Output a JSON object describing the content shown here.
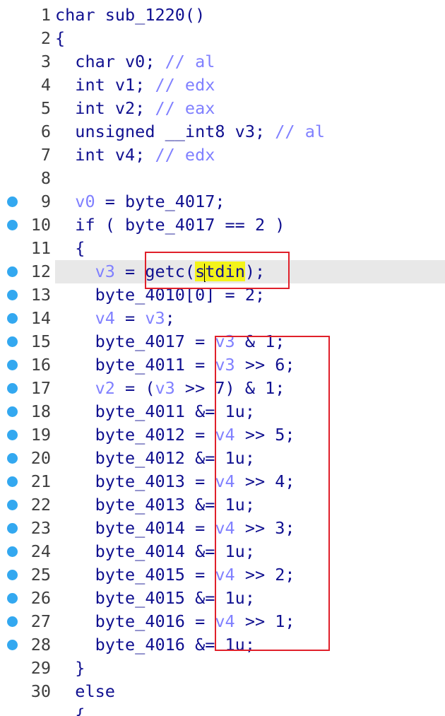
{
  "editor": {
    "lines": [
      {
        "n": "1",
        "bp": false,
        "parts": [
          [
            "plain",
            "char sub_1220()"
          ]
        ]
      },
      {
        "n": "2",
        "bp": false,
        "parts": [
          [
            "plain",
            "{"
          ]
        ]
      },
      {
        "n": "3",
        "bp": false,
        "parts": [
          [
            "plain",
            "  char v0; "
          ],
          [
            "cm",
            "// al"
          ]
        ]
      },
      {
        "n": "4",
        "bp": false,
        "parts": [
          [
            "plain",
            "  int v1; "
          ],
          [
            "cm",
            "// edx"
          ]
        ]
      },
      {
        "n": "5",
        "bp": false,
        "parts": [
          [
            "plain",
            "  int v2; "
          ],
          [
            "cm",
            "// eax"
          ]
        ]
      },
      {
        "n": "6",
        "bp": false,
        "parts": [
          [
            "plain",
            "  unsigned __int8 v3; "
          ],
          [
            "cm",
            "// al"
          ]
        ]
      },
      {
        "n": "7",
        "bp": false,
        "parts": [
          [
            "plain",
            "  int v4; "
          ],
          [
            "cm",
            "// edx"
          ]
        ]
      },
      {
        "n": "8",
        "bp": false,
        "parts": [
          [
            "plain",
            ""
          ]
        ]
      },
      {
        "n": "9",
        "bp": true,
        "parts": [
          [
            "plain",
            "  "
          ],
          [
            "var",
            "v0"
          ],
          [
            "plain",
            " = byte_4017;"
          ]
        ]
      },
      {
        "n": "10",
        "bp": true,
        "parts": [
          [
            "plain",
            "  if ( byte_4017 == 2 )"
          ]
        ]
      },
      {
        "n": "11",
        "bp": false,
        "parts": [
          [
            "plain",
            "  {"
          ]
        ]
      },
      {
        "n": "12",
        "bp": true,
        "current": true,
        "parts": [
          [
            "plain",
            "    "
          ],
          [
            "var",
            "v3"
          ],
          [
            "plain",
            " = "
          ],
          [
            "hl",
            "getc("
          ],
          [
            "hlc",
            "s"
          ],
          [
            "caret",
            ""
          ],
          [
            "hlc",
            "tdin"
          ],
          [
            "plain",
            ");"
          ]
        ]
      },
      {
        "n": "13",
        "bp": true,
        "parts": [
          [
            "plain",
            "    byte_4010[0] = 2;"
          ]
        ]
      },
      {
        "n": "14",
        "bp": true,
        "parts": [
          [
            "plain",
            "    "
          ],
          [
            "var",
            "v4"
          ],
          [
            "plain",
            " = "
          ],
          [
            "var",
            "v3"
          ],
          [
            "plain",
            ";"
          ]
        ]
      },
      {
        "n": "15",
        "bp": true,
        "parts": [
          [
            "plain",
            "    byte_4017 = "
          ],
          [
            "var",
            "v3"
          ],
          [
            "plain",
            " & 1;"
          ]
        ]
      },
      {
        "n": "16",
        "bp": true,
        "parts": [
          [
            "plain",
            "    byte_4011 = "
          ],
          [
            "var",
            "v3"
          ],
          [
            "plain",
            " >> 6;"
          ]
        ]
      },
      {
        "n": "17",
        "bp": true,
        "parts": [
          [
            "plain",
            "    "
          ],
          [
            "var",
            "v2"
          ],
          [
            "plain",
            " = ("
          ],
          [
            "var",
            "v3"
          ],
          [
            "plain",
            " >> 7) & 1;"
          ]
        ]
      },
      {
        "n": "18",
        "bp": true,
        "parts": [
          [
            "plain",
            "    byte_4011 &= 1u;"
          ]
        ]
      },
      {
        "n": "19",
        "bp": true,
        "parts": [
          [
            "plain",
            "    byte_4012 = "
          ],
          [
            "var",
            "v4"
          ],
          [
            "plain",
            " >> 5;"
          ]
        ]
      },
      {
        "n": "20",
        "bp": true,
        "parts": [
          [
            "plain",
            "    byte_4012 &= 1u;"
          ]
        ]
      },
      {
        "n": "21",
        "bp": true,
        "parts": [
          [
            "plain",
            "    byte_4013 = "
          ],
          [
            "var",
            "v4"
          ],
          [
            "plain",
            " >> 4;"
          ]
        ]
      },
      {
        "n": "22",
        "bp": true,
        "parts": [
          [
            "plain",
            "    byte_4013 &= 1u;"
          ]
        ]
      },
      {
        "n": "23",
        "bp": true,
        "parts": [
          [
            "plain",
            "    byte_4014 = "
          ],
          [
            "var",
            "v4"
          ],
          [
            "plain",
            " >> 3;"
          ]
        ]
      },
      {
        "n": "24",
        "bp": true,
        "parts": [
          [
            "plain",
            "    byte_4014 &= 1u;"
          ]
        ]
      },
      {
        "n": "25",
        "bp": true,
        "parts": [
          [
            "plain",
            "    byte_4015 = "
          ],
          [
            "var",
            "v4"
          ],
          [
            "plain",
            " >> 2;"
          ]
        ]
      },
      {
        "n": "26",
        "bp": true,
        "parts": [
          [
            "plain",
            "    byte_4015 &= 1u;"
          ]
        ]
      },
      {
        "n": "27",
        "bp": true,
        "parts": [
          [
            "plain",
            "    byte_4016 = "
          ],
          [
            "var",
            "v4"
          ],
          [
            "plain",
            " >> 1;"
          ]
        ]
      },
      {
        "n": "28",
        "bp": true,
        "parts": [
          [
            "plain",
            "    byte_4016 &= 1u;"
          ]
        ]
      },
      {
        "n": "29",
        "bp": false,
        "parts": [
          [
            "plain",
            "  }"
          ]
        ]
      },
      {
        "n": "30",
        "bp": false,
        "parts": [
          [
            "plain",
            "  else"
          ]
        ]
      },
      {
        "n": "",
        "bp": false,
        "parts": [
          [
            "plain",
            "  {"
          ]
        ]
      }
    ]
  },
  "colors": {
    "keyword": "#101090",
    "variable": "#8080ff",
    "comment": "#8080ff",
    "highlight": "#f3f31a",
    "annotation_box": "#e0202a",
    "breakpoint_dot": "#33a8f0"
  }
}
